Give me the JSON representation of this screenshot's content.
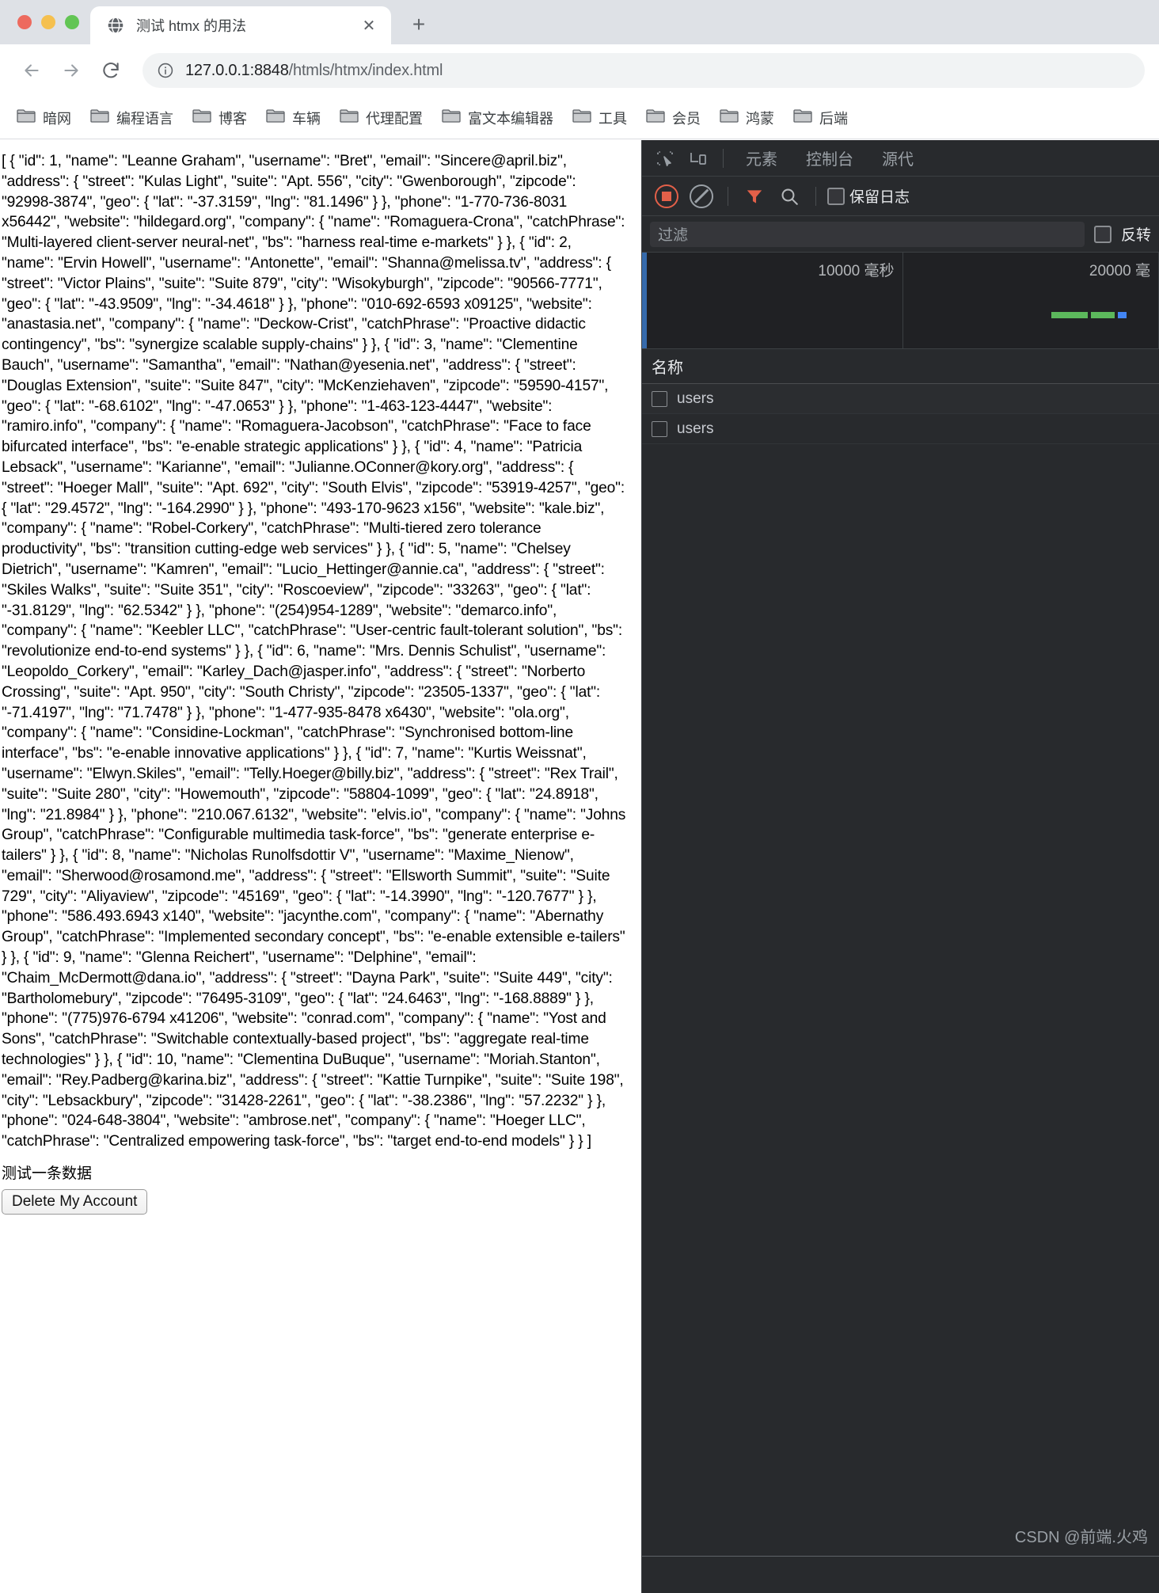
{
  "window": {
    "traffic_lights": [
      "close",
      "minimize",
      "maximize"
    ]
  },
  "tab": {
    "title": "测试 htmx 的用法",
    "favicon": "globe-icon",
    "close_label": "✕",
    "newtab_label": "+"
  },
  "toolbar": {
    "back": "←",
    "forward": "→",
    "reload": "⟳",
    "site_info_icon": "info-circle-icon",
    "url_host": "127.0.0.1:8848",
    "url_path": "/htmls/htmx/index.html",
    "url_full": "127.0.0.1:8848/htmls/htmx/index.html"
  },
  "bookmarks": [
    {
      "label": "暗网"
    },
    {
      "label": "编程语言"
    },
    {
      "label": "博客"
    },
    {
      "label": "车辆"
    },
    {
      "label": "代理配置"
    },
    {
      "label": "富文本编辑器"
    },
    {
      "label": "工具"
    },
    {
      "label": "会员"
    },
    {
      "label": "鸿蒙"
    },
    {
      "label": "后端"
    }
  ],
  "page": {
    "json_response": "[ { \"id\": 1, \"name\": \"Leanne Graham\", \"username\": \"Bret\", \"email\": \"Sincere@april.biz\", \"address\": { \"street\": \"Kulas Light\", \"suite\": \"Apt. 556\", \"city\": \"Gwenborough\", \"zipcode\": \"92998-3874\", \"geo\": { \"lat\": \"-37.3159\", \"lng\": \"81.1496\" } }, \"phone\": \"1-770-736-8031 x56442\", \"website\": \"hildegard.org\", \"company\": { \"name\": \"Romaguera-Crona\", \"catchPhrase\": \"Multi-layered client-server neural-net\", \"bs\": \"harness real-time e-markets\" } }, { \"id\": 2, \"name\": \"Ervin Howell\", \"username\": \"Antonette\", \"email\": \"Shanna@melissa.tv\", \"address\": { \"street\": \"Victor Plains\", \"suite\": \"Suite 879\", \"city\": \"Wisokyburgh\", \"zipcode\": \"90566-7771\", \"geo\": { \"lat\": \"-43.9509\", \"lng\": \"-34.4618\" } }, \"phone\": \"010-692-6593 x09125\", \"website\": \"anastasia.net\", \"company\": { \"name\": \"Deckow-Crist\", \"catchPhrase\": \"Proactive didactic contingency\", \"bs\": \"synergize scalable supply-chains\" } }, { \"id\": 3, \"name\": \"Clementine Bauch\", \"username\": \"Samantha\", \"email\": \"Nathan@yesenia.net\", \"address\": { \"street\": \"Douglas Extension\", \"suite\": \"Suite 847\", \"city\": \"McKenziehaven\", \"zipcode\": \"59590-4157\", \"geo\": { \"lat\": \"-68.6102\", \"lng\": \"-47.0653\" } }, \"phone\": \"1-463-123-4447\", \"website\": \"ramiro.info\", \"company\": { \"name\": \"Romaguera-Jacobson\", \"catchPhrase\": \"Face to face bifurcated interface\", \"bs\": \"e-enable strategic applications\" } }, { \"id\": 4, \"name\": \"Patricia Lebsack\", \"username\": \"Karianne\", \"email\": \"Julianne.OConner@kory.org\", \"address\": { \"street\": \"Hoeger Mall\", \"suite\": \"Apt. 692\", \"city\": \"South Elvis\", \"zipcode\": \"53919-4257\", \"geo\": { \"lat\": \"29.4572\", \"lng\": \"-164.2990\" } }, \"phone\": \"493-170-9623 x156\", \"website\": \"kale.biz\", \"company\": { \"name\": \"Robel-Corkery\", \"catchPhrase\": \"Multi-tiered zero tolerance productivity\", \"bs\": \"transition cutting-edge web services\" } }, { \"id\": 5, \"name\": \"Chelsey Dietrich\", \"username\": \"Kamren\", \"email\": \"Lucio_Hettinger@annie.ca\", \"address\": { \"street\": \"Skiles Walks\", \"suite\": \"Suite 351\", \"city\": \"Roscoeview\", \"zipcode\": \"33263\", \"geo\": { \"lat\": \"-31.8129\", \"lng\": \"62.5342\" } }, \"phone\": \"(254)954-1289\", \"website\": \"demarco.info\", \"company\": { \"name\": \"Keebler LLC\", \"catchPhrase\": \"User-centric fault-tolerant solution\", \"bs\": \"revolutionize end-to-end systems\" } }, { \"id\": 6, \"name\": \"Mrs. Dennis Schulist\", \"username\": \"Leopoldo_Corkery\", \"email\": \"Karley_Dach@jasper.info\", \"address\": { \"street\": \"Norberto Crossing\", \"suite\": \"Apt. 950\", \"city\": \"South Christy\", \"zipcode\": \"23505-1337\", \"geo\": { \"lat\": \"-71.4197\", \"lng\": \"71.7478\" } }, \"phone\": \"1-477-935-8478 x6430\", \"website\": \"ola.org\", \"company\": { \"name\": \"Considine-Lockman\", \"catchPhrase\": \"Synchronised bottom-line interface\", \"bs\": \"e-enable innovative applications\" } }, { \"id\": 7, \"name\": \"Kurtis Weissnat\", \"username\": \"Elwyn.Skiles\", \"email\": \"Telly.Hoeger@billy.biz\", \"address\": { \"street\": \"Rex Trail\", \"suite\": \"Suite 280\", \"city\": \"Howemouth\", \"zipcode\": \"58804-1099\", \"geo\": { \"lat\": \"24.8918\", \"lng\": \"21.8984\" } }, \"phone\": \"210.067.6132\", \"website\": \"elvis.io\", \"company\": { \"name\": \"Johns Group\", \"catchPhrase\": \"Configurable multimedia task-force\", \"bs\": \"generate enterprise e-tailers\" } }, { \"id\": 8, \"name\": \"Nicholas Runolfsdottir V\", \"username\": \"Maxime_Nienow\", \"email\": \"Sherwood@rosamond.me\", \"address\": { \"street\": \"Ellsworth Summit\", \"suite\": \"Suite 729\", \"city\": \"Aliyaview\", \"zipcode\": \"45169\", \"geo\": { \"lat\": \"-14.3990\", \"lng\": \"-120.7677\" } }, \"phone\": \"586.493.6943 x140\", \"website\": \"jacynthe.com\", \"company\": { \"name\": \"Abernathy Group\", \"catchPhrase\": \"Implemented secondary concept\", \"bs\": \"e-enable extensible e-tailers\" } }, { \"id\": 9, \"name\": \"Glenna Reichert\", \"username\": \"Delphine\", \"email\": \"Chaim_McDermott@dana.io\", \"address\": { \"street\": \"Dayna Park\", \"suite\": \"Suite 449\", \"city\": \"Bartholomebury\", \"zipcode\": \"76495-3109\", \"geo\": { \"lat\": \"24.6463\", \"lng\": \"-168.8889\" } }, \"phone\": \"(775)976-6794 x41206\", \"website\": \"conrad.com\", \"company\": { \"name\": \"Yost and Sons\", \"catchPhrase\": \"Switchable contextually-based project\", \"bs\": \"aggregate real-time technologies\" } }, { \"id\": 10, \"name\": \"Clementina DuBuque\", \"username\": \"Moriah.Stanton\", \"email\": \"Rey.Padberg@karina.biz\", \"address\": { \"street\": \"Kattie Turnpike\", \"suite\": \"Suite 198\", \"city\": \"Lebsackbury\", \"zipcode\": \"31428-2261\", \"geo\": { \"lat\": \"-38.2386\", \"lng\": \"57.2232\" } }, \"phone\": \"024-648-3804\", \"website\": \"ambrose.net\", \"company\": { \"name\": \"Hoeger LLC\", \"catchPhrase\": \"Centralized empowering task-force\", \"bs\": \"target end-to-end models\" } } ]",
    "note": "测试一条数据",
    "delete_button": "Delete My Account"
  },
  "devtools": {
    "icons": {
      "inspect": "inspect-element-icon",
      "device": "device-toolbar-icon",
      "record": "record-stop-icon",
      "clear": "clear-network-icon",
      "filter": "filter-funnel-icon",
      "search": "search-icon"
    },
    "tabs": [
      {
        "label": "元素",
        "selected": false
      },
      {
        "label": "控制台",
        "selected": false
      },
      {
        "label": "源代",
        "selected": false
      }
    ],
    "preserve_log_label": "保留日志",
    "filter_placeholder": "过滤",
    "invert_label": "反转",
    "timeline": {
      "ticks": [
        "10000 毫秒",
        "20000 毫"
      ],
      "bars": [
        {
          "color": "#5cb85c",
          "width": 46
        },
        {
          "color": "#5cb85c",
          "width": 30
        },
        {
          "color": "#4285f4",
          "width": 11
        }
      ]
    },
    "list_header": "名称",
    "requests": [
      {
        "name": "users"
      },
      {
        "name": "users"
      }
    ],
    "watermark": "CSDN @前端.火鸡"
  },
  "colors": {
    "accent_red": "#e36049",
    "devtools_bg": "#282a2d",
    "devtools_panel": "#202124",
    "link_blue": "#4285f4",
    "green": "#5cb85c"
  }
}
